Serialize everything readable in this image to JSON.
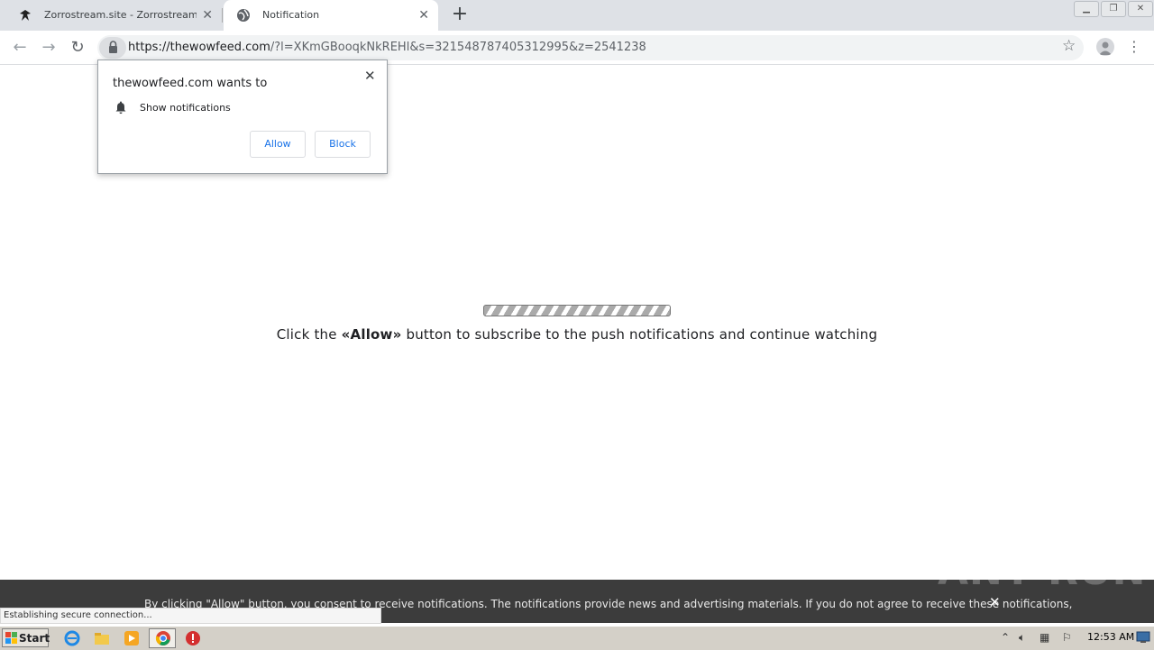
{
  "browser": {
    "tabs": [
      {
        "title": "Zorrostream.site - Zorrostream - Live",
        "icon": "zorro-icon",
        "active": false
      },
      {
        "title": "Notification",
        "icon": "globe-icon",
        "active": true
      }
    ],
    "new_tab": "+",
    "url_domain": "https://thewowfeed.com",
    "url_rest": "/?l=XKmGBooqkNkREHl&s=321548787405312995&z=2541238",
    "status_text": "Establishing secure connection..."
  },
  "permission_popup": {
    "title": "thewowfeed.com wants to",
    "item": "Show notifications",
    "allow_label": "Allow",
    "block_label": "Block"
  },
  "page": {
    "cta_before": "Click the ",
    "cta_bold": "«Allow»",
    "cta_after": " button to subscribe to the push notifications and continue watching"
  },
  "consent_bar": {
    "text": "By clicking \"Allow\" button, you consent to receive notifications. The notifications provide news and advertising materials. If you do not agree to receive these notifications,"
  },
  "watermark": "ANY RUN",
  "taskbar": {
    "start_label": "Start",
    "clock": "12:53 AM"
  },
  "colors": {
    "accent": "#1a73e8",
    "tabstrip": "#dee1e6",
    "consent_bg": "#3c3c3c",
    "taskbar": "#d4d0c8"
  }
}
